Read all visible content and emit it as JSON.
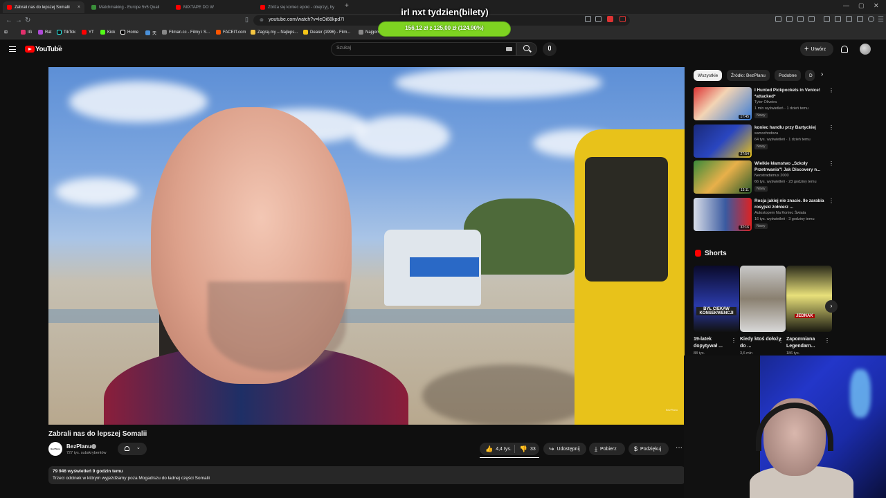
{
  "browser": {
    "tabs": [
      {
        "title": "Zabrali nas do lepszej Somalii",
        "active": true
      },
      {
        "title": "Matchmaking - Europe 5v5 Quali",
        "active": false
      },
      {
        "title": "MIXTAPE DO W",
        "active": false
      },
      {
        "title": "Zbliża się koniec epoki - obejrzyj, by",
        "active": false
      }
    ],
    "tab_close": "×",
    "new_tab": "+",
    "url": "youtube.com/watch?v=leOi68kpd7I",
    "bookmarks": [
      "IG",
      "Rat",
      "TikTok",
      "YT",
      "Kick",
      "Home",
      "天",
      "Filman.cc - Filmy i S...",
      "FACEIT.com",
      "Zagraj.my – Najleps...",
      "Dealer (1996) - Film...",
      "Najgorsz"
    ]
  },
  "donation": {
    "title": "irl nxt tydzien(bilety)",
    "progress_text": "156,12 zł  z  125,00 zł  (124.90%)",
    "current": 156.12,
    "goal": 125.0,
    "percent": 124.9,
    "color": "#7ed321"
  },
  "youtube": {
    "logo": "YouTube",
    "logo_region": "PL",
    "search_placeholder": "Szukaj",
    "create_label": "Utwórz"
  },
  "video": {
    "title": "Zabrali nas do lepszej Somalii",
    "watermark": "BezPlanu",
    "channel": "BezPlanu",
    "channel_avatar_text": "BezPlanu",
    "subscribers": "727 tys. subskrybentów",
    "likes": "4,4 tys.",
    "dislikes": "33",
    "share": "Udostępnij",
    "download": "Pobierz",
    "thanks": "Podziękuj",
    "more": "···",
    "stats": "79 946 wyświetleń  9 godzin temu",
    "description": "Trzeci odcinek w którym wyjeżdżamy poza Mogadiszu do ładnej części Somalii"
  },
  "sidebar": {
    "chips": [
      "Wszystkie",
      "Źródło: BezPlanu",
      "Podobne",
      "D"
    ],
    "chip_next": "›",
    "recommendations": [
      {
        "title": "I Hunted Pickpockets in Venice! *attacked*",
        "channel": "Tyler Oliveira",
        "meta": "1 mln wyświetleń · 1 dzień temu",
        "badge": "Nowy",
        "duration": "17:45"
      },
      {
        "title": "koniec handlu przy Bartyckiej",
        "channel": "samochodoza",
        "meta": "64 tys. wyświetleń · 1 dzień temu",
        "badge": "Nowy",
        "duration": "27:54"
      },
      {
        "title": "Wielkie kłamstwo „Szkoły Przetrwania\"! Jak Discovery n...",
        "channel": "Neostradamus 2000",
        "meta": "66 tys. wyświetleń · 23 godziny temu",
        "badge": "Nowy",
        "duration": "13:11"
      },
      {
        "title": "Rosja jakiej nie znacie. Ile zarabia rosyjski żołnierz ...",
        "channel": "Autostopem Na Koniec Świata",
        "meta": "16 tys. wyświetleń · 3 godziny temu",
        "badge": "Nowy",
        "duration": "32:16"
      }
    ],
    "kebab": "⋮",
    "shorts_label": "Shorts",
    "shorts": [
      {
        "title": "19-latek dopytywał ...",
        "views": "88 tys.",
        "overlay": "BYŁ CIEKAW KONSEKWENCJI"
      },
      {
        "title": "Kiedy ktoś dołoży do ...",
        "views": "3,6 mln",
        "overlay": ""
      },
      {
        "title": "Zapomniana Legendarn...",
        "views": "186 tys.",
        "overlay": "JEDNAK"
      }
    ],
    "shorts_next": "›"
  }
}
